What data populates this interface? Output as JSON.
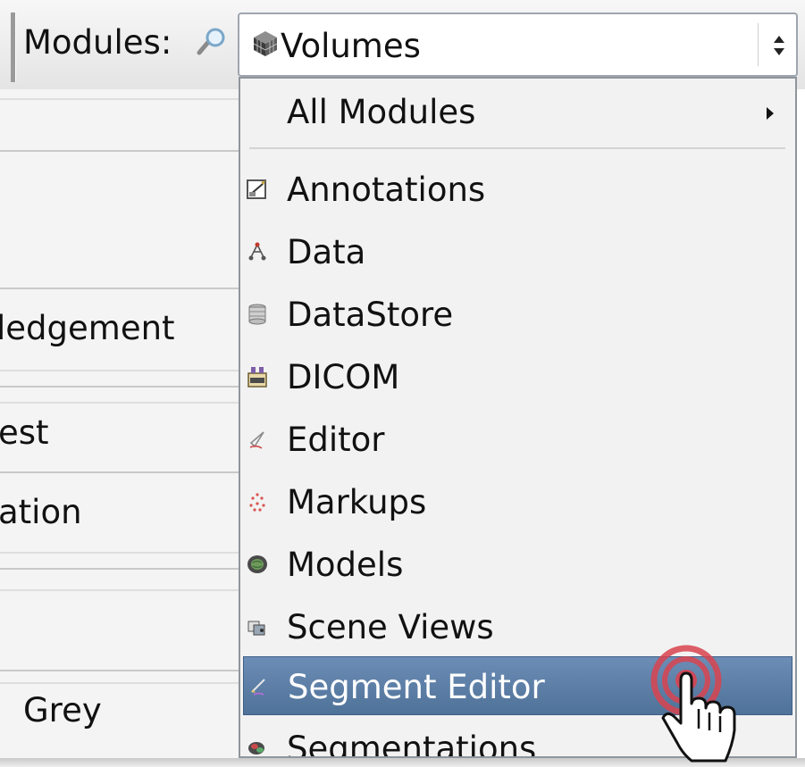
{
  "toolbar": {
    "modules_label": "Modules:",
    "search_icon": "magnifier-icon",
    "selected_module": "Volumes",
    "selected_module_icon": "volume-cube-icon"
  },
  "background_labels": {
    "acknowledgement": "ledgement",
    "interest": "est",
    "information": "ation",
    "grey": "Grey"
  },
  "menu": {
    "all_modules": "All Modules",
    "items": [
      {
        "label": "Annotations",
        "icon": "annotations-icon"
      },
      {
        "label": "Data",
        "icon": "data-tree-icon"
      },
      {
        "label": "DataStore",
        "icon": "datastore-icon"
      },
      {
        "label": "DICOM",
        "icon": "dicom-icon"
      },
      {
        "label": "Editor",
        "icon": "editor-icon"
      },
      {
        "label": "Markups",
        "icon": "markups-icon"
      },
      {
        "label": "Models",
        "icon": "models-icon"
      },
      {
        "label": "Scene Views",
        "icon": "scene-views-icon"
      },
      {
        "label": "Segment Editor",
        "icon": "segment-editor-icon",
        "selected": true
      },
      {
        "label": "Segmentations",
        "icon": "segmentations-icon"
      }
    ]
  },
  "colors": {
    "selection_background": "#5a7ca4",
    "click_indicator": "#d9434f"
  }
}
